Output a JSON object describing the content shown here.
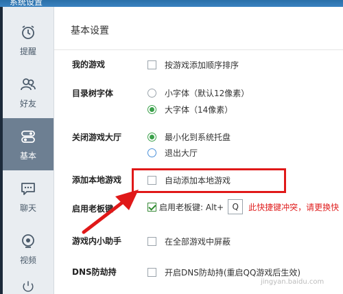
{
  "window": {
    "title": "系统设置"
  },
  "sidebar": {
    "items": [
      {
        "label": "提醒",
        "icon": "alarm-clock-icon"
      },
      {
        "label": "好友",
        "icon": "friends-icon"
      },
      {
        "label": "基本",
        "icon": "toggle-switch-icon",
        "active": true
      },
      {
        "label": "聊天",
        "icon": "chat-bubble-icon"
      },
      {
        "label": "视频",
        "icon": "video-icon"
      },
      {
        "label": "",
        "icon": "more-icon"
      }
    ]
  },
  "header": {
    "title": "基本设置"
  },
  "settings": {
    "my_games": {
      "label": "我的游戏",
      "option": "按游戏添加顺序排序",
      "checked": false
    },
    "tree_font": {
      "label": "目录树字体",
      "options": [
        {
          "text": "小字体（默认12像素）",
          "checked": false
        },
        {
          "text": "大字体（14像素）",
          "checked": true
        }
      ]
    },
    "close_hall": {
      "label": "关闭游戏大厅",
      "options": [
        {
          "text": "最小化到系统托盘",
          "checked": true
        },
        {
          "text": "退出大厅",
          "checked": false
        }
      ]
    },
    "add_local": {
      "label": "添加本地游戏",
      "option": "自动添加本地游戏",
      "checked": false
    },
    "boss_key": {
      "label": "启用老板键",
      "option": "启用老板键: Alt+",
      "checked": true,
      "key": "Q",
      "warning": "此快捷键冲突，请更换快"
    },
    "in_game": {
      "label": "游戏内小助手",
      "option": "在全部游戏中屏蔽",
      "checked": false
    },
    "dns": {
      "label": "DNS防劫持",
      "option": "开启DNS防劫持(重启QQ游戏后生效)",
      "checked": false
    }
  },
  "annotation_color": "#e01818",
  "watermark": "jingyan.baidu.com"
}
